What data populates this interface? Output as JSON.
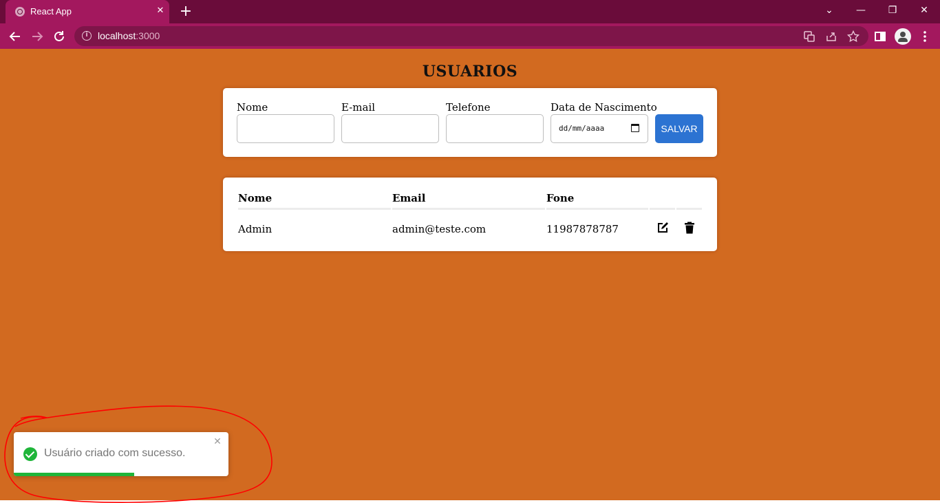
{
  "browser": {
    "tab_title": "React App",
    "tab_close": "✕",
    "new_tab": "+",
    "url_host": "localhost",
    "url_port": ":3000",
    "window_controls": {
      "list": "⌄",
      "minimize": "—",
      "restore": "❐",
      "close": "✕"
    }
  },
  "page": {
    "title": "USUARIOS"
  },
  "form": {
    "fields": [
      {
        "label": "Nome",
        "value": ""
      },
      {
        "label": "E-mail",
        "value": ""
      },
      {
        "label": "Telefone",
        "value": ""
      },
      {
        "label": "Data de Nascimento",
        "placeholder": "dd/mm/aaaa"
      }
    ],
    "save_label": "SALVAR"
  },
  "table": {
    "headers": [
      "Nome",
      "Email",
      "Fone"
    ],
    "rows": [
      {
        "nome": "Admin",
        "email": "admin@teste.com",
        "fone": "11987878787"
      }
    ]
  },
  "toast": {
    "message": "Usuário criado com sucesso.",
    "close": "✕",
    "progress": 0.56,
    "status_color": "#1fb53a"
  },
  "colors": {
    "page_background": "#d26a20",
    "browser_accent": "#a3185e",
    "primary_button": "#2c73d2",
    "annotation": "#ff0000"
  },
  "icons": [
    "info-icon",
    "translate-icon",
    "share-icon",
    "star-icon",
    "side-panel-icon",
    "profile-icon",
    "menu-icon",
    "edit-icon",
    "trash-icon",
    "check-circle-icon",
    "calendar-icon"
  ]
}
